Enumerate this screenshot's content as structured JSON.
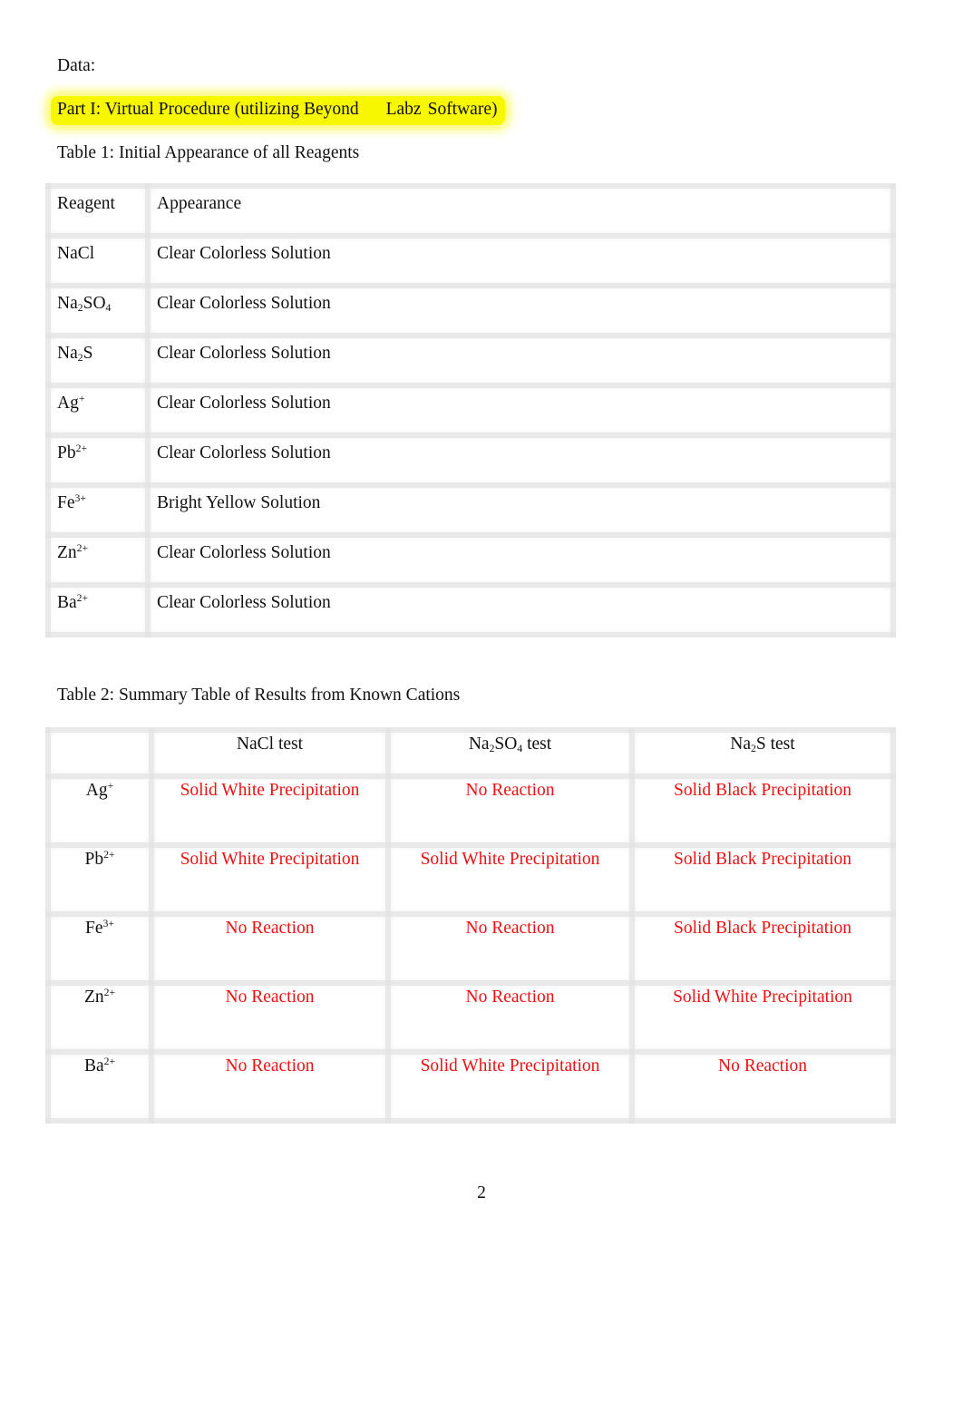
{
  "document": {
    "section_label": "Data:",
    "part_heading": {
      "part1": "Part I: Virtual Procedure (utilizing Beyond",
      "part2": "Labz",
      "part3": "Software)",
      "highlight_color": "#f6f700"
    },
    "page_number": "2"
  },
  "table1": {
    "caption": "Table 1: Initial Appearance of all Reagents",
    "headers": [
      "Reagent",
      "Appearance"
    ],
    "rows": [
      {
        "reagent": {
          "base": "NaCl",
          "sub1": "",
          "mid": "",
          "sub2": "",
          "sup": ""
        },
        "appearance": "Clear Colorless Solution"
      },
      {
        "reagent": {
          "base": "Na",
          "sub1": "2",
          "mid": "SO",
          "sub2": "4",
          "sup": ""
        },
        "appearance": "Clear Colorless Solution"
      },
      {
        "reagent": {
          "base": "Na",
          "sub1": "2",
          "mid": "S",
          "sub2": "",
          "sup": ""
        },
        "appearance": "Clear Colorless Solution"
      },
      {
        "reagent": {
          "base": "Ag",
          "sub1": "",
          "mid": "",
          "sub2": "",
          "sup": "+"
        },
        "appearance": "Clear Colorless Solution"
      },
      {
        "reagent": {
          "base": "Pb",
          "sub1": "",
          "mid": "",
          "sub2": "",
          "sup": "2+"
        },
        "appearance": "Clear Colorless Solution"
      },
      {
        "reagent": {
          "base": "Fe",
          "sub1": "",
          "mid": "",
          "sub2": "",
          "sup": "3+"
        },
        "appearance": "Bright Yellow Solution"
      },
      {
        "reagent": {
          "base": "Zn",
          "sub1": "",
          "mid": "",
          "sub2": "",
          "sup": "2+"
        },
        "appearance": "Clear Colorless Solution"
      },
      {
        "reagent": {
          "base": "Ba",
          "sub1": "",
          "mid": "",
          "sub2": "",
          "sup": "2+"
        },
        "appearance": "Clear Colorless Solution"
      }
    ]
  },
  "table2": {
    "caption": "Table 2: Summary Table of Results from Known Cations",
    "headers": [
      {
        "base": "NaCl test",
        "sub1": "",
        "mid": "",
        "sub2": "",
        "tail": ""
      },
      {
        "base": "Na",
        "sub1": "2",
        "mid": "SO",
        "sub2": "4",
        "tail": " test"
      },
      {
        "base": "Na",
        "sub1": "2",
        "mid": "S test",
        "sub2": "",
        "tail": ""
      }
    ],
    "result_color": "#ee1111",
    "rows": [
      {
        "cation": {
          "base": "Ag",
          "sup": "+"
        },
        "results": [
          "Solid White Precipitation",
          "No Reaction",
          "Solid Black Precipitation"
        ]
      },
      {
        "cation": {
          "base": "Pb",
          "sup": "2+"
        },
        "results": [
          "Solid White Precipitation",
          "Solid White Precipitation",
          "Solid Black Precipitation"
        ]
      },
      {
        "cation": {
          "base": "Fe",
          "sup": "3+"
        },
        "results": [
          "No Reaction",
          "No Reaction",
          "Solid Black Precipitation"
        ]
      },
      {
        "cation": {
          "base": "Zn",
          "sup": "2+"
        },
        "results": [
          "No Reaction",
          "No Reaction",
          "Solid White Precipitation"
        ]
      },
      {
        "cation": {
          "base": "Ba",
          "sup": "2+"
        },
        "results": [
          "No Reaction",
          "Solid White Precipitation",
          "No Reaction"
        ]
      }
    ]
  }
}
